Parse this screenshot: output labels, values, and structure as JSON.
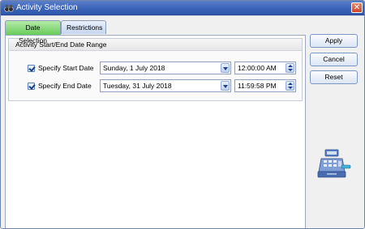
{
  "window": {
    "title": "Activity Selection",
    "close_glyph": "✕",
    "icon": "binoculars-icon"
  },
  "tabs": [
    {
      "label": "Date Selection",
      "active": true
    },
    {
      "label": "Restrictions",
      "active": false
    }
  ],
  "group": {
    "title": "Activity Start/End Date Range"
  },
  "rows": {
    "start": {
      "checkbox_label": "Specify Start Date",
      "checked": true,
      "date": "Sunday, 1 July 2018",
      "time": "12:00:00 AM"
    },
    "end": {
      "checkbox_label": "Specify End Date",
      "checked": true,
      "date": "Tuesday, 31 July 2018",
      "time": "11:59:58 PM"
    }
  },
  "buttons": {
    "apply": "Apply",
    "cancel": "Cancel",
    "reset": "Reset"
  },
  "decor": {
    "icon": "cash-register-icon"
  },
  "colors": {
    "title_bar": "#3b63b8",
    "active_tab": "#67cc5a",
    "button_border": "#7d97c4"
  }
}
